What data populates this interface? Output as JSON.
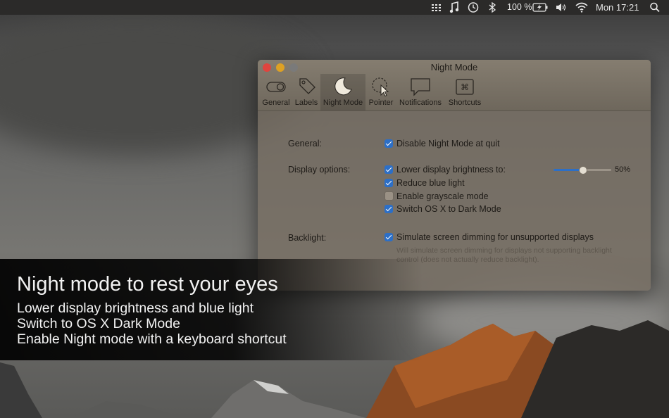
{
  "menubar": {
    "battery": "100 %",
    "clock": "Mon 17:21",
    "icons": [
      "grid-icon",
      "music-note-icon",
      "time-machine-icon",
      "bluetooth-icon",
      "battery-icon",
      "volume-icon",
      "wifi-icon",
      "search-icon"
    ]
  },
  "window": {
    "title": "Night Mode",
    "tabs": [
      {
        "label": "General",
        "icon": "toggle-icon"
      },
      {
        "label": "Labels",
        "icon": "tag-icon"
      },
      {
        "label": "Night Mode",
        "icon": "moon-icon",
        "active": true
      },
      {
        "label": "Pointer",
        "icon": "pointer-icon"
      },
      {
        "label": "Notifications",
        "icon": "speech-bubble-icon"
      },
      {
        "label": "Shortcuts",
        "icon": "command-key-icon"
      }
    ],
    "general": {
      "label": "General:",
      "disable_at_quit": {
        "text": "Disable Night Mode at quit",
        "checked": true
      }
    },
    "display": {
      "label": "Display options:",
      "lower_brightness": {
        "text": "Lower display brightness to:",
        "checked": true
      },
      "brightness_value": "50%",
      "brightness_fraction": 0.5,
      "reduce_blue": {
        "text": "Reduce blue light",
        "checked": true
      },
      "grayscale": {
        "text": "Enable grayscale mode",
        "checked": false
      },
      "dark_mode": {
        "text": "Switch OS X to Dark Mode",
        "checked": true
      }
    },
    "backlight": {
      "label": "Backlight:",
      "simulate": {
        "text": "Simulate screen dimming for unsupported displays",
        "checked": true
      },
      "note": "Will simulate screen dimming for displays not supporting backlight control (does not actually reduce backlight)."
    }
  },
  "banner": {
    "headline": "Night mode to rest your eyes",
    "line1": "Lower display brightness and blue light",
    "line2": "Switch to OS X Dark Mode",
    "line3": "Enable Night mode with a keyboard shortcut"
  },
  "colors": {
    "accent": "#2c6fc7",
    "close": "#e0443e",
    "minimize": "#dea123",
    "zoom": "#7a7a7a"
  }
}
